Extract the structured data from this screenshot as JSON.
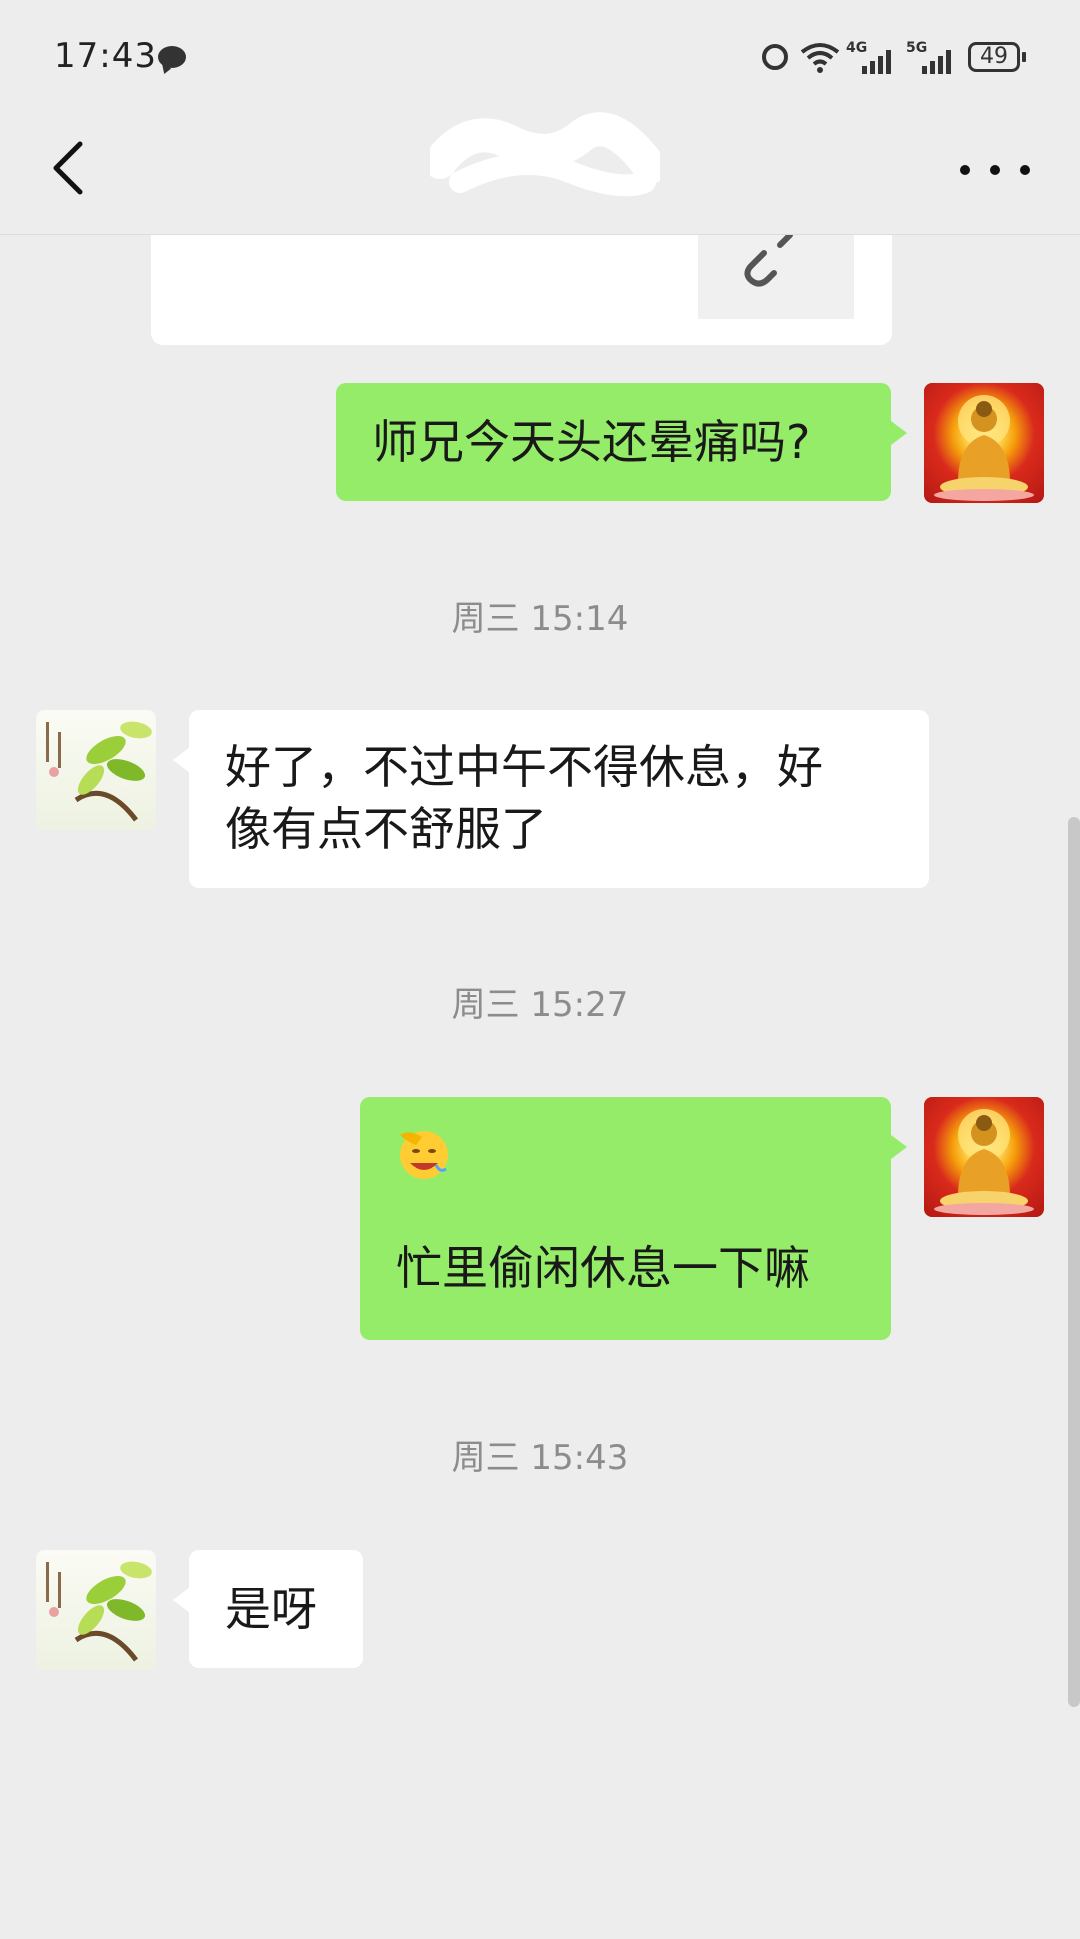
{
  "status_bar": {
    "time": "17:43",
    "network_1": "4G",
    "network_2": "5G",
    "battery": "49"
  },
  "header": {
    "title": "",
    "back_icon": "chevron-left-icon",
    "more_icon": "more-dots-icon"
  },
  "messages": [
    {
      "type": "link-card",
      "from": "other",
      "thumb_icon": "link-icon"
    },
    {
      "type": "text",
      "from": "me",
      "text": "师兄今天头还晕痛吗?"
    },
    {
      "type": "timestamp",
      "text": "周三 15:14"
    },
    {
      "type": "text",
      "from": "other",
      "lines": [
        "好了，不过中午不得休息，好",
        "像有点不舒服了"
      ]
    },
    {
      "type": "timestamp",
      "text": "周三 15:27"
    },
    {
      "type": "text",
      "from": "me",
      "emoji": "face-palm-emoji",
      "text": "忙里偷闲休息一下嘛"
    },
    {
      "type": "timestamp",
      "text": "周三 15:43"
    },
    {
      "type": "text",
      "from": "other",
      "text": "是呀"
    }
  ],
  "colors": {
    "background": "#ededed",
    "my_bubble": "#95ec69",
    "other_bubble": "#ffffff",
    "timestamp": "#8c8c8c"
  }
}
